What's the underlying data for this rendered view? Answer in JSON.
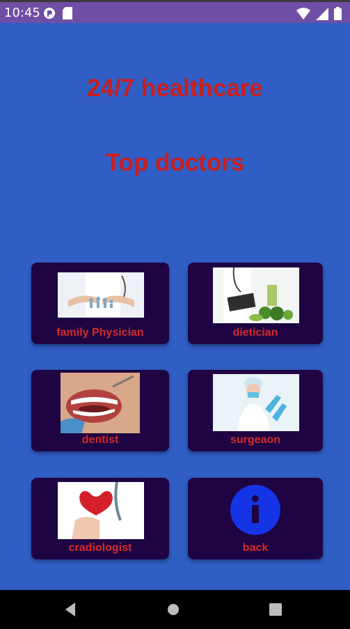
{
  "status_bar": {
    "time": "10:45",
    "icons": [
      "app-notification-icon",
      "sd-card-icon",
      "wifi-icon",
      "cell-signal-icon",
      "battery-icon"
    ]
  },
  "main": {
    "title": "24/7 healthcare",
    "subtitle": "Top doctors"
  },
  "cards": [
    {
      "label": "family Physician",
      "image": "family-physician-photo"
    },
    {
      "label": "dietician",
      "image": "dietician-photo"
    },
    {
      "label": "dentist",
      "image": "dentist-photo"
    },
    {
      "label": "surgeaon",
      "image": "surgeon-photo"
    },
    {
      "label": "cradiologist",
      "image": "cardiologist-photo"
    },
    {
      "label": "back",
      "image": "info-icon"
    }
  ],
  "colors": {
    "background": "#305ec4",
    "status_bar": "#6f4fa6",
    "card": "#1f0444",
    "text_accent": "#c81e1e",
    "info_icon": "#1434e6"
  },
  "nav_bar": {
    "icons": [
      "back-triangle-icon",
      "home-circle-icon",
      "recents-square-icon"
    ]
  }
}
